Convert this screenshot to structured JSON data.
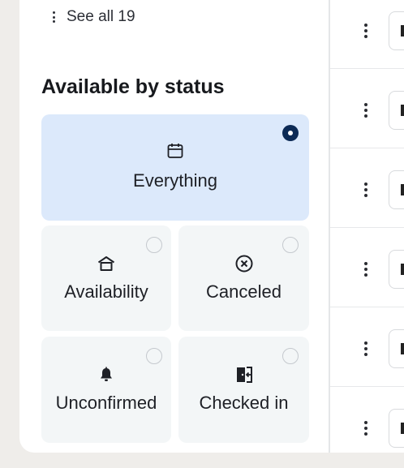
{
  "sidebar": {
    "see_all_label": "See all 19",
    "section_title": "Available by status",
    "status_options": [
      {
        "label": "Everything",
        "icon": "calendar-icon",
        "selected": true
      },
      {
        "label": "Availability",
        "icon": "home-icon",
        "selected": false
      },
      {
        "label": "Canceled",
        "icon": "x-circle-icon",
        "selected": false
      },
      {
        "label": "Unconfirmed",
        "icon": "bell-icon",
        "selected": false
      },
      {
        "label": "Checked in",
        "icon": "door-enter-icon",
        "selected": false
      }
    ]
  },
  "colors": {
    "selected_card": "#dce9fb",
    "card": "#f3f6f7",
    "radio_selected": "#0c2a55",
    "background": "#efedea"
  }
}
